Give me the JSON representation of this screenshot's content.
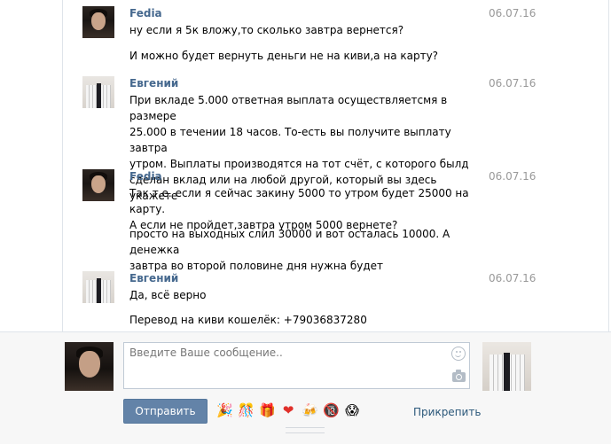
{
  "messages": [
    {
      "author": "Fedia",
      "avatar_icon": "user-avatar-fedia",
      "date": "06.07.16",
      "texts": [
        "ну если я 5к вложу,то сколько завтра вернется?",
        "И можно будет вернуть деньги не на киви,а на карту?"
      ]
    },
    {
      "author": "Евгений",
      "avatar_icon": "user-avatar-evgeniy",
      "date": "06.07.16",
      "texts": [
        "При вкладе 5.000 ответная выплата осуществляетсмя в размере\n25.000 в течении 18 часов. То-есть вы получите выплату завтра\nутром. Выплаты производятся на тот счёт, с которого былд\nсделан вклад или на любой другой, который вы здесь укажете"
      ]
    },
    {
      "author": "Fedia",
      "avatar_icon": "user-avatar-fedia",
      "date": "06.07.16",
      "texts": [
        "Так т.е. если я сейчас закину 5000 то утром будет 25000 на карту.\nА если не пройдет,завтра утром 5000 вернете?",
        "просто на выходных слил 30000 и вот осталась 10000. А денежка\nзавтра во второй половине дня нужна будет"
      ]
    },
    {
      "author": "Евгений",
      "avatar_icon": "user-avatar-evgeniy",
      "date": "06.07.16",
      "texts": [
        "Да, всё верно",
        "Перевод на киви кошелёк: +79036837280"
      ]
    }
  ],
  "composer": {
    "placeholder": "Введите Ваше сообщение..",
    "send_label": "Отправить",
    "attach_label": "Прикрепить",
    "emoji_icons": [
      "🎉",
      "🎊",
      "🎁",
      "❤",
      "🍻",
      "🔞",
      "😱"
    ]
  },
  "colors": {
    "author": "#45688e",
    "date": "#999999",
    "send_button": "#6383a8",
    "link": "#2b587a"
  }
}
